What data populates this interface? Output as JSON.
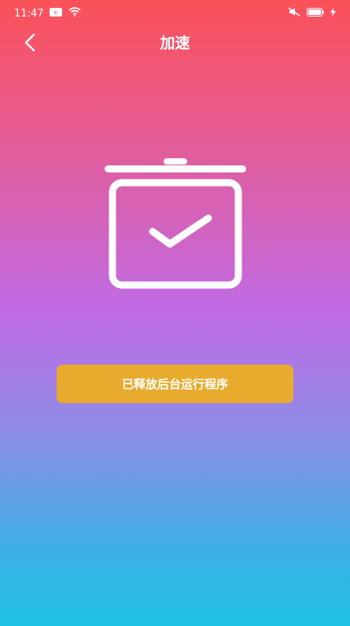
{
  "status_bar": {
    "time": "11:47",
    "icons": [
      "notification-icon",
      "wifi-icon",
      "mute-icon",
      "battery-icon",
      "charging-icon"
    ]
  },
  "nav": {
    "back_icon": "chevron-left-icon",
    "title": "加速"
  },
  "main": {
    "icon": "cleaned-trash-check-icon",
    "status_text": "已释放后台运行程序"
  },
  "colors": {
    "gradient_top": "#FB5158",
    "gradient_mid": "#C06BE6",
    "gradient_bottom": "#1EC2E6",
    "button": "#E8AB2E"
  }
}
